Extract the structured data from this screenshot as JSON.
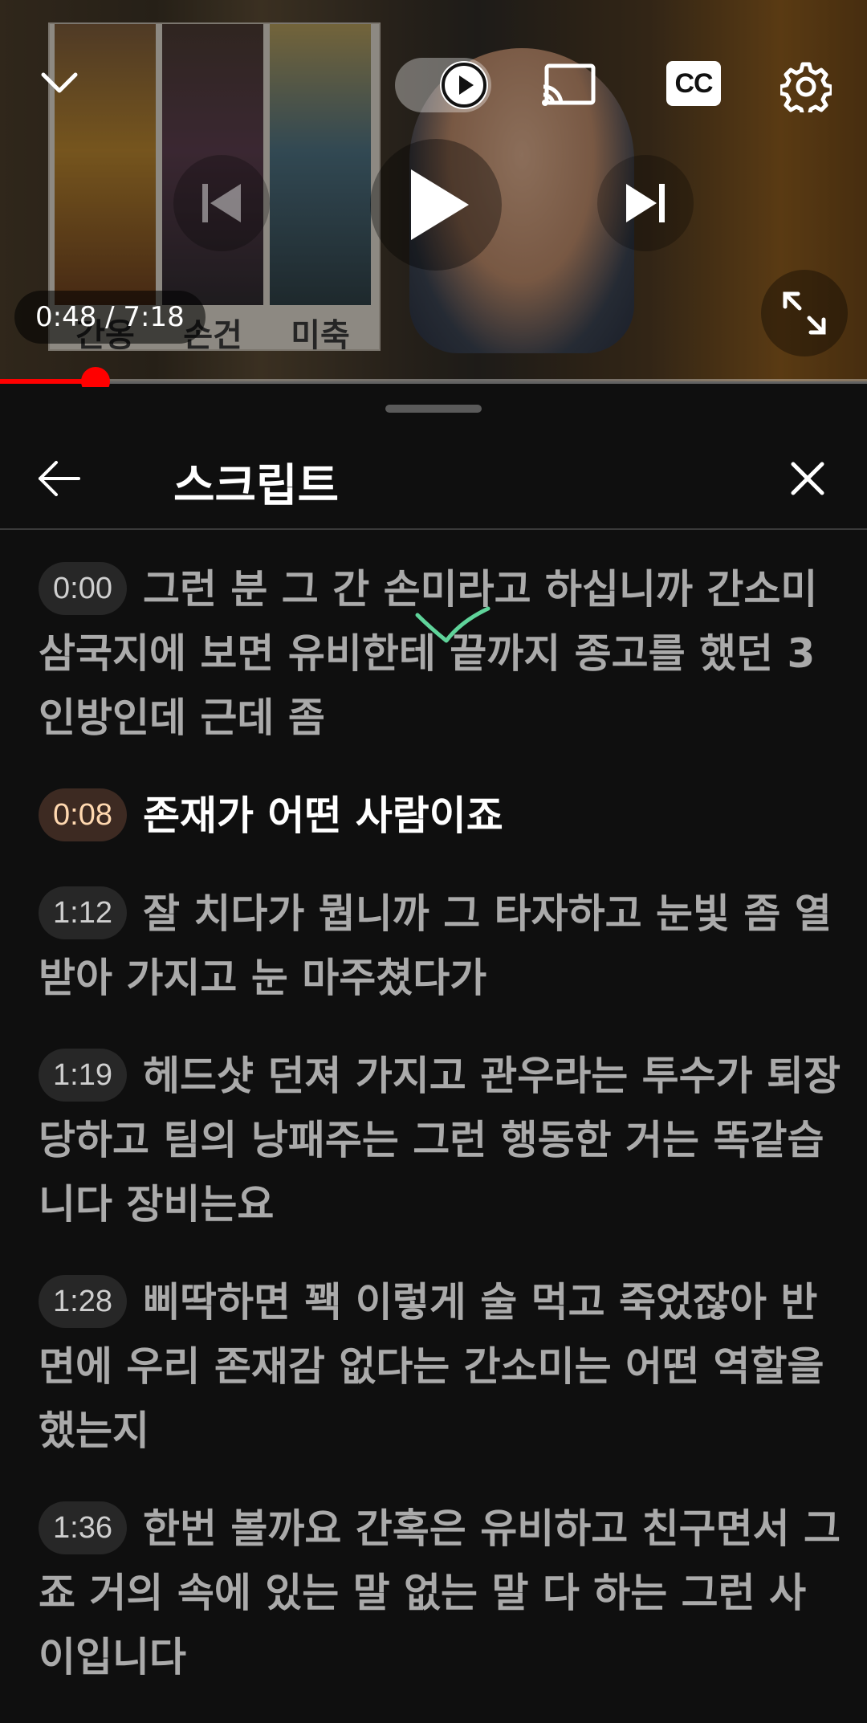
{
  "player": {
    "poster_captions": [
      "간옹",
      "손건",
      "미축"
    ],
    "time_display": "0:48 / 7:18",
    "progress_fraction": 0.11,
    "accent_color": "#ff0000",
    "icons": {
      "collapse": "chevron-down-icon",
      "autoplay": "autoplay-toggle-icon",
      "cast": "cast-icon",
      "cc": "closed-captions-icon",
      "settings": "gear-icon",
      "prev": "previous-icon",
      "play": "play-icon",
      "next": "next-icon",
      "fullscreen": "fullscreen-icon"
    },
    "cc_label": "CC"
  },
  "transcript": {
    "title": "스크립트",
    "segments": [
      {
        "time": "0:00",
        "text": "그런 분 그 간 손미라고 하십니까 간소미 삼국지에 보면 유비한테 끝까지 종고를 했던 3인방인데 근데 좀",
        "active": false
      },
      {
        "time": "0:08",
        "text": "존재가 어떤 사람이죠",
        "active": true
      },
      {
        "time": "1:12",
        "text": "잘 치다가 뭡니까 그 타자하고 눈빛 좀 열 받아 가지고 눈 마주쳤다가",
        "active": false
      },
      {
        "time": "1:19",
        "text": "헤드샷 던져 가지고 관우라는 투수가 퇴장당하고 팀의 낭패주는 그런 행동한 거는 똑같습니다 장비는요",
        "active": false
      },
      {
        "time": "1:28",
        "text": "삐딱하면 꽥 이렇게 술 먹고 죽었잖아 반면에 우리 존재감 없다는 간소미는 어떤 역할을 했는지",
        "active": false
      },
      {
        "time": "1:36",
        "text": "한번 볼까요 간혹은 유비하고 친구면서 그죠 거의 속에 있는 말 없는 말 다 하는 그런 사이입니다",
        "active": false
      }
    ]
  }
}
